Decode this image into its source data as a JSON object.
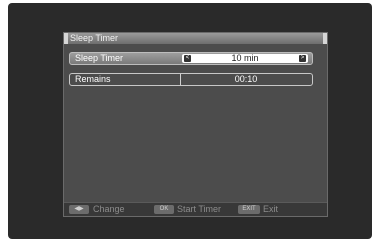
{
  "dialog": {
    "title": "Sleep Timer"
  },
  "rows": [
    {
      "label": "Sleep Timer",
      "value": "10 min",
      "left_arrow": "<",
      "right_arrow": ">"
    },
    {
      "label": "Remains",
      "value": "00:10"
    }
  ],
  "footer": {
    "change_key": "◀▶",
    "change_label": "Change",
    "ok_key": "OK",
    "start_label": "Start Timer",
    "exit_key": "EXIT",
    "exit_label": "Exit"
  }
}
